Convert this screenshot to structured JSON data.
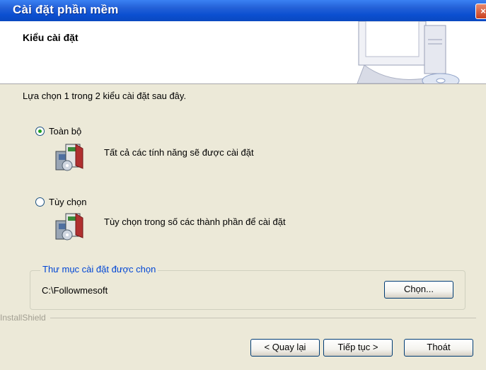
{
  "window": {
    "title": "Cài đặt phần mềm",
    "close_glyph": "×"
  },
  "header": {
    "title": "Kiểu cài đặt"
  },
  "prompt": "Lựa chọn 1 trong 2 kiểu cài đặt sau đây.",
  "options": [
    {
      "label": "Toàn bộ",
      "description": "Tất cả các tính năng sẽ được cài đặt",
      "selected": true
    },
    {
      "label": "Tùy chọn",
      "description": "Tùy chọn trong số các thành phần để cài đặt",
      "selected": false
    }
  ],
  "folder_group": {
    "legend": "Thư mục cài đặt được chọn",
    "path": "C:\\Followmesoft",
    "browse_label": "Chọn..."
  },
  "footer": {
    "brand": "InstallShield",
    "back_label": "< Quay lại",
    "next_label": "Tiếp tục >",
    "exit_label": "Thoát"
  },
  "colors": {
    "titlebar": "#0b4fd1",
    "group_legend": "#0046d5",
    "radio_dot": "#21a121"
  }
}
